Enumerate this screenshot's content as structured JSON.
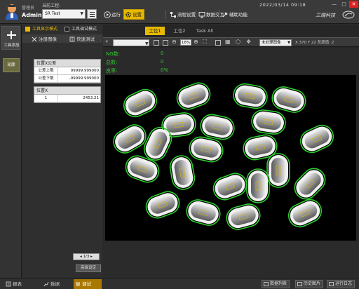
{
  "user": {
    "role": "管理员",
    "name": "Admin"
  },
  "project": {
    "label": "当前工程:",
    "value": "SR Test"
  },
  "toolbar": {
    "run": "运行",
    "settings": "设置",
    "flow": "流程设置",
    "interact": "数据交互",
    "aux": "辅助功能"
  },
  "datetime": "2022/03/14  09:18",
  "brand": "三瑞科技",
  "tool_column": {
    "add_label": "工具添加",
    "items": [
      {
        "label": "轮廓"
      }
    ]
  },
  "panel": {
    "modes": [
      {
        "label": "工具显示模式",
        "checked": true
      },
      {
        "label": "工具调试模式",
        "checked": false
      }
    ],
    "tabs": [
      {
        "label": "注册图像"
      },
      {
        "label": "快速测试"
      }
    ],
    "table1": {
      "title": "位置X公差",
      "rows": [
        {
          "k": "公差上限",
          "v": "99999.999000"
        },
        {
          "k": "公差下限",
          "v": "-99999.999000"
        }
      ]
    },
    "table2": {
      "title": "位置X",
      "rows": [
        {
          "k": "1",
          "v": "2453.21"
        }
      ]
    },
    "pager": "1/3",
    "advanced": "高级设定"
  },
  "main": {
    "tabs": [
      {
        "label": "工位1",
        "active": true
      },
      {
        "label": "工位2",
        "active": false
      },
      {
        "label": "Task All",
        "active": false
      }
    ],
    "zoom": "16%",
    "view_select": "未处理图像",
    "coord": "X 370 Y 22 灰度值: 2",
    "stats": [
      {
        "k": "NG数:",
        "v": "0"
      },
      {
        "k": "总数:",
        "v": "0"
      },
      {
        "k": "良率:",
        "v": "0%"
      }
    ]
  },
  "bottom": {
    "tabs": [
      {
        "label": "报表",
        "active": false
      },
      {
        "label": "数据",
        "active": false
      },
      {
        "label": "调试",
        "active": true
      }
    ],
    "right": [
      {
        "label": "数据列表"
      },
      {
        "label": "历史图片"
      },
      {
        "label": "运行日志"
      }
    ]
  },
  "colors": {
    "accent": "#e6b800",
    "ok_green": "#32c832",
    "close_red": "#e02020"
  }
}
